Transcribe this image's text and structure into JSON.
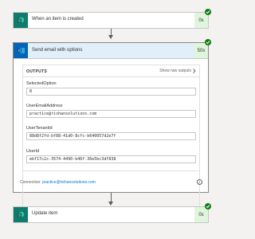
{
  "steps": {
    "trigger": {
      "title": "When an item is created",
      "duration": "0s",
      "icon": "sharepoint-icon"
    },
    "email": {
      "title": "Send email with options",
      "duration": "50s",
      "icon": "outlook-icon"
    },
    "update": {
      "title": "Update item",
      "duration": "0s",
      "icon": "sharepoint-icon"
    }
  },
  "outputs": {
    "title": "OUTPUTS",
    "show_raw": "Show raw outputs",
    "fields": [
      {
        "label": "SelectedOption",
        "value": "8"
      },
      {
        "label": "UserEmailAddress",
        "value": "practice@rishansolutions.com"
      },
      {
        "label": "UserTenantId",
        "value": "88d8f2fd-bf88-41d0-8cfc-b640057d2e7f"
      },
      {
        "label": "UserId",
        "value": "ebf17c2c-3574-4490-b46f-36e5bc3df838"
      }
    ]
  },
  "connection": {
    "label": "Connection:",
    "value": "practice@rishansolutions.com"
  },
  "colors": {
    "sharepoint": "#0f7b6c",
    "outlook": "#0364b8",
    "success": "#107c10",
    "duration_bg": "#dff6dd",
    "header_bg": "#e1effa"
  }
}
